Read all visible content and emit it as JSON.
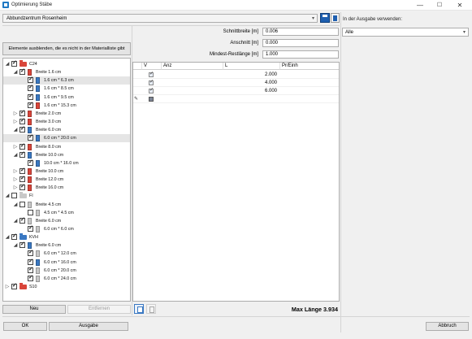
{
  "window": {
    "title": "Optimierung Stäbe",
    "minimize": "—",
    "maximize": "☐",
    "close": "✕"
  },
  "location_combo": {
    "value": "Abbundzentrum Rosenheim",
    "arrow": "▾"
  },
  "ausgabe": {
    "label": "In der Ausgabe verwenden:",
    "value": "Alle",
    "arrow": "▾"
  },
  "hide_button": "Elemente ausblenden, die es nicht in der Materialliste gibt",
  "tree": [
    {
      "label": "C24",
      "depth": 0,
      "exp": "◢",
      "checked": true,
      "icon": "folder",
      "color": "#d9453a"
    },
    {
      "label": "Breite 1.6 cm",
      "depth": 1,
      "exp": "◢",
      "checked": true,
      "icon": "bar",
      "color": "#d9453a"
    },
    {
      "label": "1.6 cm * 6.3 cm",
      "depth": 2,
      "exp": "",
      "checked": true,
      "icon": "bar",
      "color": "#3a78c2",
      "selected": true
    },
    {
      "label": "1.6 cm * 8.5 cm",
      "depth": 2,
      "exp": "",
      "checked": true,
      "icon": "bar",
      "color": "#3a78c2"
    },
    {
      "label": "1.6 cm * 9.5 cm",
      "depth": 2,
      "exp": "",
      "checked": true,
      "icon": "bar",
      "color": "#3a78c2"
    },
    {
      "label": "1.6 cm * 15.3 cm",
      "depth": 2,
      "exp": "",
      "checked": true,
      "icon": "bar",
      "color": "#d9453a"
    },
    {
      "label": "Breite 2.0 cm",
      "depth": 1,
      "exp": "▷",
      "checked": true,
      "icon": "bar",
      "color": "#d9453a"
    },
    {
      "label": "Breite 3.0 cm",
      "depth": 1,
      "exp": "▷",
      "checked": true,
      "icon": "bar",
      "color": "#d9453a"
    },
    {
      "label": "Breite 6.0 cm",
      "depth": 1,
      "exp": "◢",
      "checked": true,
      "icon": "bar",
      "color": "#3a78c2"
    },
    {
      "label": "6.0 cm * 20.0 cm",
      "depth": 2,
      "exp": "",
      "checked": true,
      "icon": "bar",
      "color": "#3a78c2",
      "selected": true
    },
    {
      "label": "Breite 8.0 cm",
      "depth": 1,
      "exp": "▷",
      "checked": true,
      "icon": "bar",
      "color": "#d9453a"
    },
    {
      "label": "Breite 10.0 cm",
      "depth": 1,
      "exp": "◢",
      "checked": true,
      "icon": "bar",
      "color": "#3a78c2"
    },
    {
      "label": "10.0 cm * 16.0 cm",
      "depth": 2,
      "exp": "",
      "checked": true,
      "icon": "bar",
      "color": "#3a78c2"
    },
    {
      "label": "Breite 10.0 cm",
      "depth": 1,
      "exp": "▷",
      "checked": true,
      "icon": "bar",
      "color": "#d9453a"
    },
    {
      "label": "Breite 12.0 cm",
      "depth": 1,
      "exp": "▷",
      "checked": true,
      "icon": "bar",
      "color": "#d9453a"
    },
    {
      "label": "Breite 16.0 cm",
      "depth": 1,
      "exp": "▷",
      "checked": true,
      "icon": "bar",
      "color": "#d9453a"
    },
    {
      "label": "FI",
      "depth": 0,
      "exp": "◢",
      "checked": false,
      "icon": "folder",
      "color": "#c8c8c8"
    },
    {
      "label": "Breite 4.5 cm",
      "depth": 1,
      "exp": "◢",
      "checked": false,
      "icon": "bar",
      "color": "#c8c8c8"
    },
    {
      "label": "4.5 cm * 4.5 cm",
      "depth": 2,
      "exp": "",
      "checked": false,
      "icon": "bar",
      "color": "#c8c8c8"
    },
    {
      "label": "Breite 6.0 cm",
      "depth": 1,
      "exp": "◢",
      "checked": true,
      "icon": "bar",
      "color": "#c8c8c8"
    },
    {
      "label": "6.0 cm * 6.0 cm",
      "depth": 2,
      "exp": "",
      "checked": true,
      "icon": "bar",
      "color": "#c8c8c8"
    },
    {
      "label": "KVH",
      "depth": 0,
      "exp": "◢",
      "checked": true,
      "icon": "folder",
      "color": "#3a78c2"
    },
    {
      "label": "Breite 6.0 cm",
      "depth": 1,
      "exp": "◢",
      "checked": true,
      "icon": "bar",
      "color": "#3a78c2"
    },
    {
      "label": "6.0 cm * 12.0 cm",
      "depth": 2,
      "exp": "",
      "checked": true,
      "icon": "bar",
      "color": "#c8c8c8"
    },
    {
      "label": "6.0 cm * 16.0 cm",
      "depth": 2,
      "exp": "",
      "checked": true,
      "icon": "bar",
      "color": "#3a78c2"
    },
    {
      "label": "6.0 cm * 20.0 cm",
      "depth": 2,
      "exp": "",
      "checked": true,
      "icon": "bar",
      "color": "#c8c8c8"
    },
    {
      "label": "6.0 cm * 24.0 cm",
      "depth": 2,
      "exp": "",
      "checked": true,
      "icon": "bar",
      "color": "#c8c8c8"
    },
    {
      "label": "S10",
      "depth": 0,
      "exp": "▷",
      "checked": true,
      "icon": "folder",
      "color": "#d9453a"
    }
  ],
  "tree_buttons": {
    "new": "Neu",
    "remove": "Entfernen"
  },
  "params": [
    {
      "label": "Schnittbreite  [m]",
      "value": "0.006"
    },
    {
      "label": "Anschnitt  [m]",
      "value": "0.000"
    },
    {
      "label": "Mindest-Restlänge  [m]",
      "value": "1.000"
    }
  ],
  "grid": {
    "headers": [
      "V",
      "Anz",
      "L",
      "Pr/Einh"
    ],
    "rows": [
      {
        "checked": true,
        "L": "2.000"
      },
      {
        "checked": true,
        "L": "4.000"
      },
      {
        "checked": true,
        "L": "6.000"
      },
      {
        "checked": false,
        "L": "",
        "new_row": true,
        "marker": "✎"
      }
    ]
  },
  "max_length": "Max Länge 3.934",
  "footer": {
    "ok": "OK",
    "output": "Ausgabe",
    "cancel": "Abbruch"
  }
}
